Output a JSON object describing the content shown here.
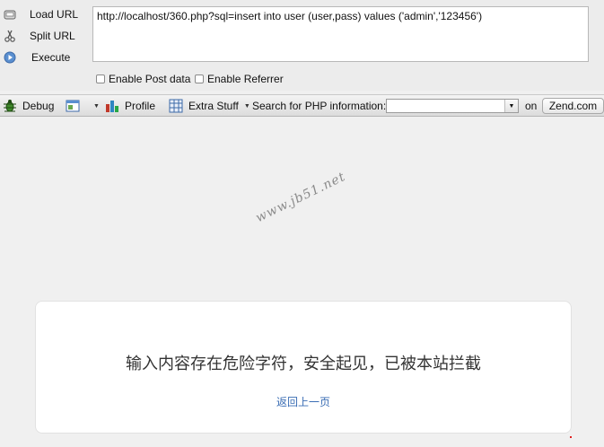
{
  "hackbar": {
    "load_url_label": "Load URL",
    "split_url_label": "Split URL",
    "execute_label": "Execute",
    "url_value": "http://localhost/360.php?sql=insert into user (user,pass) values ('admin','123456')",
    "enable_post_label": "Enable Post data",
    "enable_referrer_label": "Enable Referrer"
  },
  "toolbar": {
    "debug_label": "Debug",
    "profile_label": "Profile",
    "extra_stuff_label": "Extra Stuff",
    "search_label": "Search for PHP information:",
    "search_value": "",
    "on_label": "on",
    "site_button_label": "Zend.com"
  },
  "watermark": "www.jb51.net",
  "page": {
    "message": "输入内容存在危险字符，安全起见，已被本站拦截",
    "back_link": "返回上一页"
  },
  "colors": {
    "background": "#f0f0f0",
    "card": "#ffffff",
    "link": "#3a6db4"
  }
}
